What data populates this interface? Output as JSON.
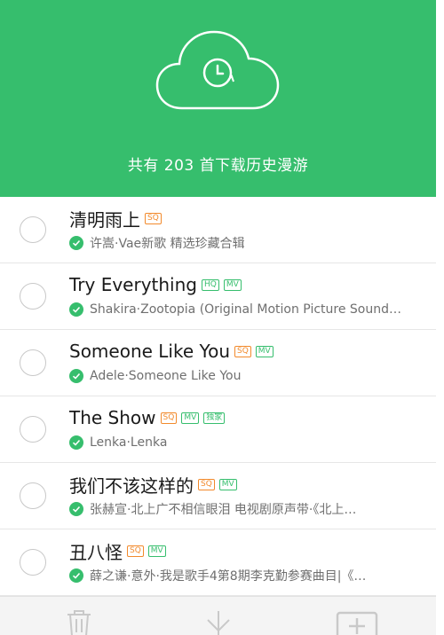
{
  "header": {
    "title": "共有 203 首下载历史漫游",
    "icon": "cloud-clock-icon",
    "background": "#36be6d"
  },
  "songs": [
    {
      "title": "清明雨上",
      "tags": [
        {
          "text": "SQ",
          "color": "orange"
        }
      ],
      "subtitle": "许嵩·Vae新歌 精选珍藏合辑"
    },
    {
      "title": "Try Everything",
      "tags": [
        {
          "text": "HQ",
          "color": "green"
        },
        {
          "text": "MV",
          "color": "green"
        }
      ],
      "subtitle": "Shakira·Zootopia (Original Motion Picture Sound…"
    },
    {
      "title": "Someone Like You",
      "tags": [
        {
          "text": "SQ",
          "color": "orange"
        },
        {
          "text": "MV",
          "color": "green"
        }
      ],
      "subtitle": "Adele·Someone Like You"
    },
    {
      "title": "The Show",
      "tags": [
        {
          "text": "SQ",
          "color": "orange"
        },
        {
          "text": "MV",
          "color": "green"
        },
        {
          "text": "独家",
          "color": "green"
        }
      ],
      "subtitle": "Lenka·Lenka"
    },
    {
      "title": "我们不该这样的",
      "tags": [
        {
          "text": "SQ",
          "color": "orange"
        },
        {
          "text": "MV",
          "color": "green"
        }
      ],
      "subtitle": "张赫宣·北上广不相信眼泪 电视剧原声带·《北上…"
    },
    {
      "title": "丑八怪",
      "tags": [
        {
          "text": "SQ",
          "color": "orange"
        },
        {
          "text": "MV",
          "color": "green"
        }
      ],
      "subtitle": "薛之谦·意外·我是歌手4第8期李克勤参赛曲目|《…"
    }
  ],
  "toolbar": {
    "icons": [
      "trash-icon",
      "download-icon",
      "add-to-playlist-icon"
    ]
  },
  "colors": {
    "accent": "#36be6d",
    "tag_orange": "#f28a2c"
  }
}
